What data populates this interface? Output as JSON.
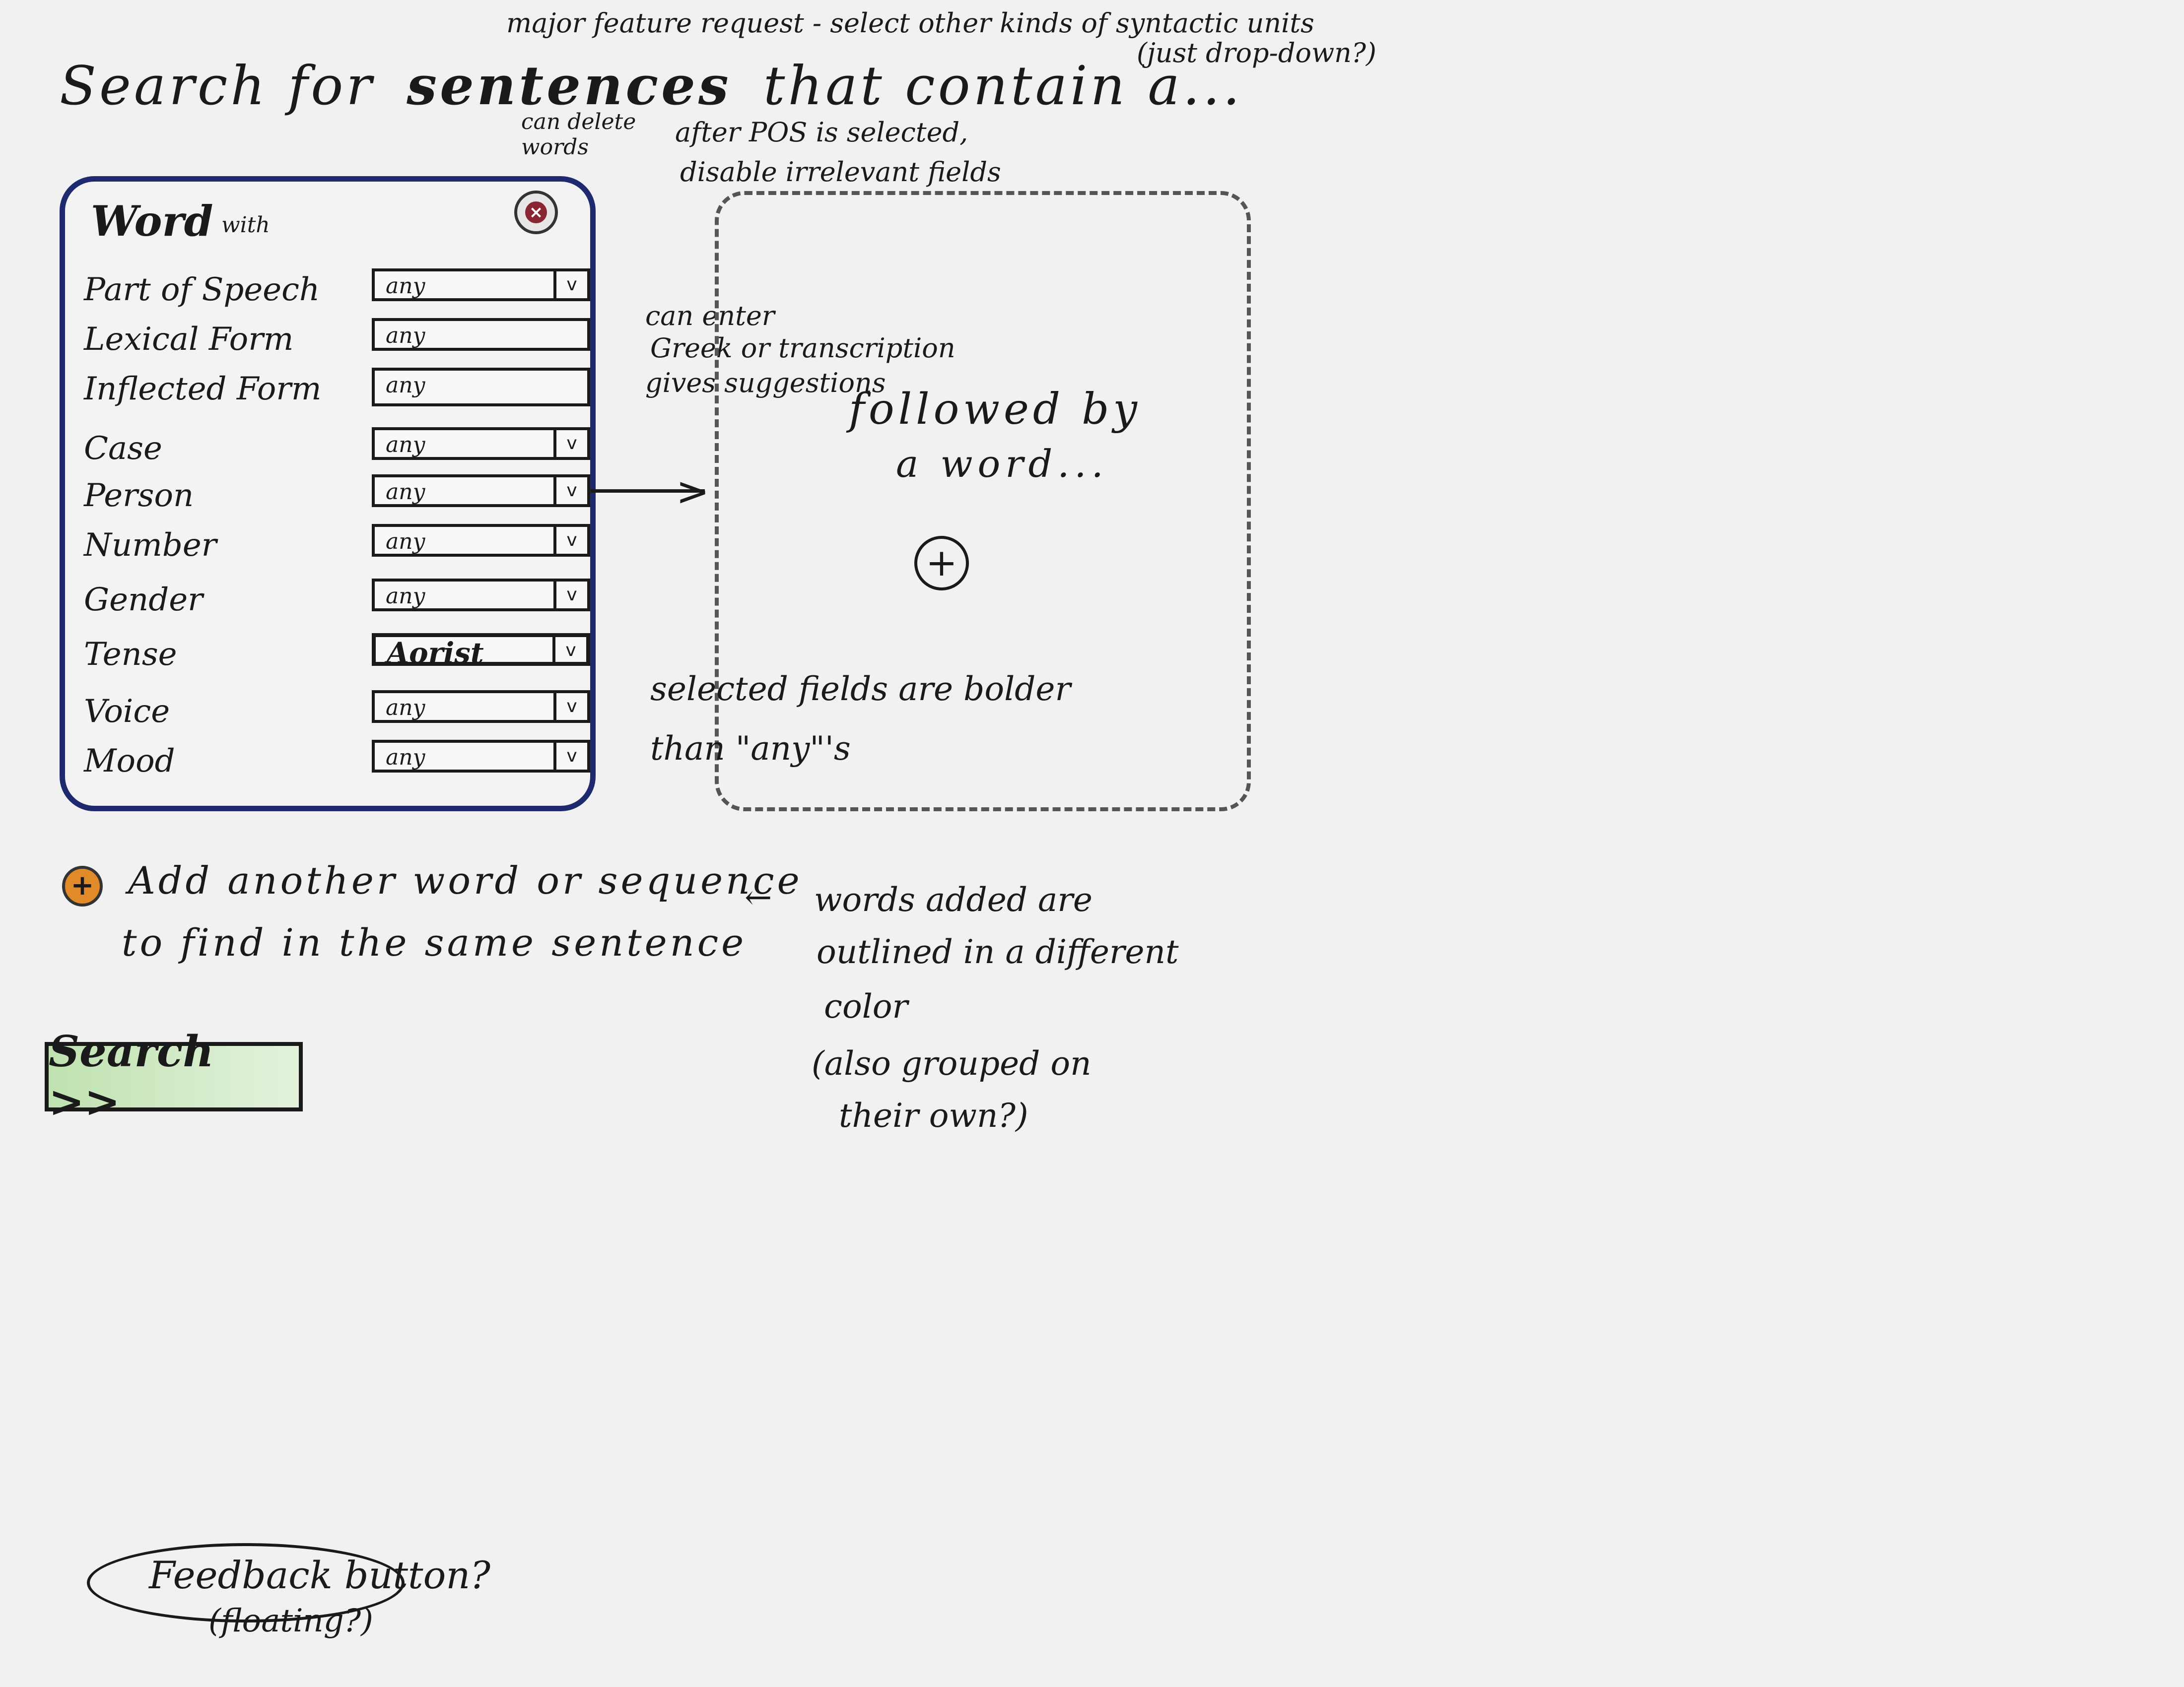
{
  "header": {
    "prefix": "Search for",
    "unit_word": "sentences",
    "suffix": "that contain a..."
  },
  "word_card": {
    "title": "Word",
    "with_label": "with",
    "delete_icon": "close-icon",
    "fields": [
      {
        "label": "Part of Speech",
        "value": "any",
        "type": "dropdown"
      },
      {
        "label": "Lexical Form",
        "value": "any",
        "type": "text"
      },
      {
        "label": "Inflected Form",
        "value": "any",
        "type": "text"
      },
      {
        "label": "Case",
        "value": "any",
        "type": "dropdown"
      },
      {
        "label": "Person",
        "value": "any",
        "type": "dropdown"
      },
      {
        "label": "Number",
        "value": "any",
        "type": "dropdown"
      },
      {
        "label": "Gender",
        "value": "any",
        "type": "dropdown"
      },
      {
        "label": "Tense",
        "value": "Aorist",
        "type": "dropdown",
        "selected": true
      },
      {
        "label": "Voice",
        "value": "any",
        "type": "dropdown"
      },
      {
        "label": "Mood",
        "value": "any",
        "type": "dropdown"
      }
    ]
  },
  "next_word": {
    "title": "followed by",
    "subtitle": "a word...",
    "add_icon": "plus-icon"
  },
  "add_another": {
    "icon": "plus-icon",
    "line1": "Add another word or sequence",
    "line2": "to find in the same sentence"
  },
  "search_button": {
    "label": "Search >>",
    "color": "#bfe2b0"
  },
  "feedback": {
    "line1": "Feedback button?",
    "line2": "(floating?)"
  },
  "annotations": {
    "major_feature": "major feature request - select other kinds of syntactic units",
    "dropdown_q": "(just drop-down?)",
    "can_delete": "can delete words",
    "after_pos": "after POS is selected,",
    "disable_fields": "disable irrelevant fields",
    "can_enter": "can enter",
    "greek": "Greek or transcription",
    "suggestions": "gives suggestions",
    "selected_bolder": "selected fields are bolder",
    "than_any": "than \"any\"'s",
    "words_added": "words added are",
    "outlined": "outlined in a different",
    "color": "color",
    "also_grouped": "(also grouped on",
    "their_own": "their own?)"
  },
  "colors": {
    "card_border": "#1f2a6e",
    "delete_fill": "#8a2534",
    "add_fill": "#e08a2a",
    "search_fill": "#bfe2b0"
  }
}
